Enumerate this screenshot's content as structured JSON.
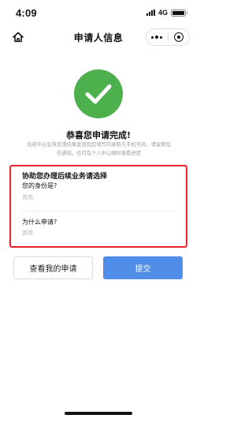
{
  "status_bar": {
    "time": "4:09",
    "network": "4G"
  },
  "nav": {
    "title": "申请人信息",
    "home_icon": "home-icon",
    "more_icon": "more-dots-icon",
    "close_icon": "target-circle-icon"
  },
  "success": {
    "icon": "check-circle-icon",
    "icon_color": "#4cb04c",
    "title": "恭喜您申请完成!",
    "description": "后续平台会将反馈结果发送到您填写的承租方手机号码，请留意短信通知。也可在个人中心随时查看进度"
  },
  "followup": {
    "heading": "协助您办理后续业务请选择",
    "highlight_color": "#e8232b",
    "questions": [
      {
        "label": "您的身份是?",
        "value": "其他"
      },
      {
        "label": "为什么申请?",
        "value": "其他"
      }
    ]
  },
  "buttons": {
    "view_label": "查看我的申请",
    "submit_label": "提交",
    "submit_color": "#4f8de8"
  }
}
